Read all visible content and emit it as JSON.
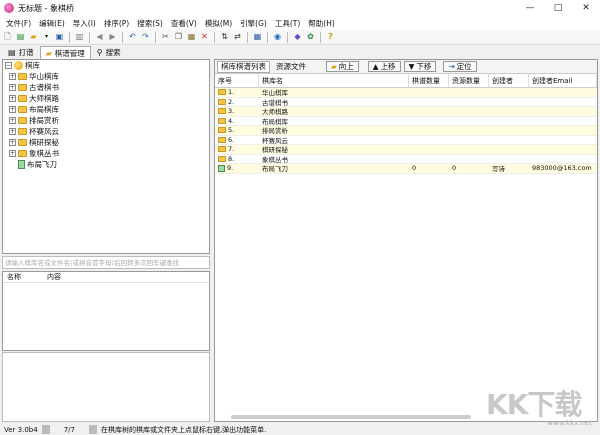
{
  "window": {
    "title": "无标题 - 象棋桥",
    "minimize": "—",
    "maximize": "□",
    "close": "✕"
  },
  "menu": [
    "文件(F)",
    "编辑(E)",
    "导入(I)",
    "排序(P)",
    "搜索(S)",
    "查看(V)",
    "模拟(M)",
    "引擎(G)",
    "工具(T)",
    "帮助(H)"
  ],
  "toolbar_icons": [
    "new-file-icon",
    "database-icon",
    "open-folder-icon",
    "dropdown-icon",
    "save-icon",
    "separator",
    "recycle-bin-icon",
    "separator",
    "back-icon",
    "forward-icon",
    "separator",
    "undo-icon",
    "redo-icon",
    "separator",
    "cut-icon",
    "copy-icon",
    "paste-icon",
    "delete-icon",
    "separator",
    "sort-icon",
    "swap-icon",
    "separator",
    "board-icon",
    "separator",
    "engine-icon",
    "separator",
    "tag-icon",
    "settings-icon",
    "separator",
    "help-icon"
  ],
  "tabs": [
    {
      "label": "打谱",
      "icon": "notebook-icon"
    },
    {
      "label": "棋谱管理",
      "icon": "folder-icon",
      "active": true
    },
    {
      "label": "搜索",
      "icon": "magnifier-icon"
    }
  ],
  "tree": {
    "root": "棋库",
    "items": [
      {
        "label": "华山棋库",
        "type": "folder"
      },
      {
        "label": "古谱棋书",
        "type": "folder"
      },
      {
        "label": "大师棋路",
        "type": "folder"
      },
      {
        "label": "布局棋库",
        "type": "folder"
      },
      {
        "label": "排局赏析",
        "type": "folder"
      },
      {
        "label": "杯赛风云",
        "type": "folder"
      },
      {
        "label": "棋研探秘",
        "type": "folder"
      },
      {
        "label": "象棋丛书",
        "type": "folder"
      },
      {
        "label": "布局飞刀",
        "type": "book"
      }
    ]
  },
  "search": {
    "placeholder": "请输入棋库名或文件名(或拼音首字母)后回转多次回车键查找"
  },
  "properties": {
    "col_name": "名称",
    "col_content": "内容"
  },
  "right_toolbar": {
    "tab_list": "棋库棋谱列表",
    "tab_resource": "资源文件",
    "up_btn": "向上",
    "move_up_btn": "上移",
    "move_down_btn": "下移",
    "locate_btn": "定位"
  },
  "grid": {
    "headers": [
      "序号",
      "棋库名",
      "棋谱数量",
      "资源数量",
      "创建者",
      "创建者Email"
    ],
    "rows": [
      {
        "no": "1.",
        "name": "华山棋库",
        "games": "",
        "res": "",
        "creator": "",
        "email": "",
        "type": "folder"
      },
      {
        "no": "2.",
        "name": "古谱棋书",
        "games": "",
        "res": "",
        "creator": "",
        "email": "",
        "type": "folder"
      },
      {
        "no": "3.",
        "name": "大师棋路",
        "games": "",
        "res": "",
        "creator": "",
        "email": "",
        "type": "folder"
      },
      {
        "no": "4.",
        "name": "布局棋库",
        "games": "",
        "res": "",
        "creator": "",
        "email": "",
        "type": "folder"
      },
      {
        "no": "5.",
        "name": "排局赏析",
        "games": "",
        "res": "",
        "creator": "",
        "email": "",
        "type": "folder"
      },
      {
        "no": "6.",
        "name": "杯赛风云",
        "games": "",
        "res": "",
        "creator": "",
        "email": "",
        "type": "folder"
      },
      {
        "no": "7.",
        "name": "棋研探秘",
        "games": "",
        "res": "",
        "creator": "",
        "email": "",
        "type": "folder"
      },
      {
        "no": "8.",
        "name": "象棋丛书",
        "games": "",
        "res": "",
        "creator": "",
        "email": "",
        "type": "folder"
      },
      {
        "no": "9.",
        "name": "布局飞刀",
        "games": "0",
        "res": "0",
        "creator": "写诗",
        "email": "983000@163.com",
        "type": "book"
      }
    ]
  },
  "status": {
    "version": "Ver 3.0b4",
    "count": "7/7",
    "hint": "在棋库树的棋库或文件夹上点鼠标右键,弹出功能菜单."
  },
  "watermark": {
    "text": "KK下载",
    "url": "www.kkx.net"
  }
}
